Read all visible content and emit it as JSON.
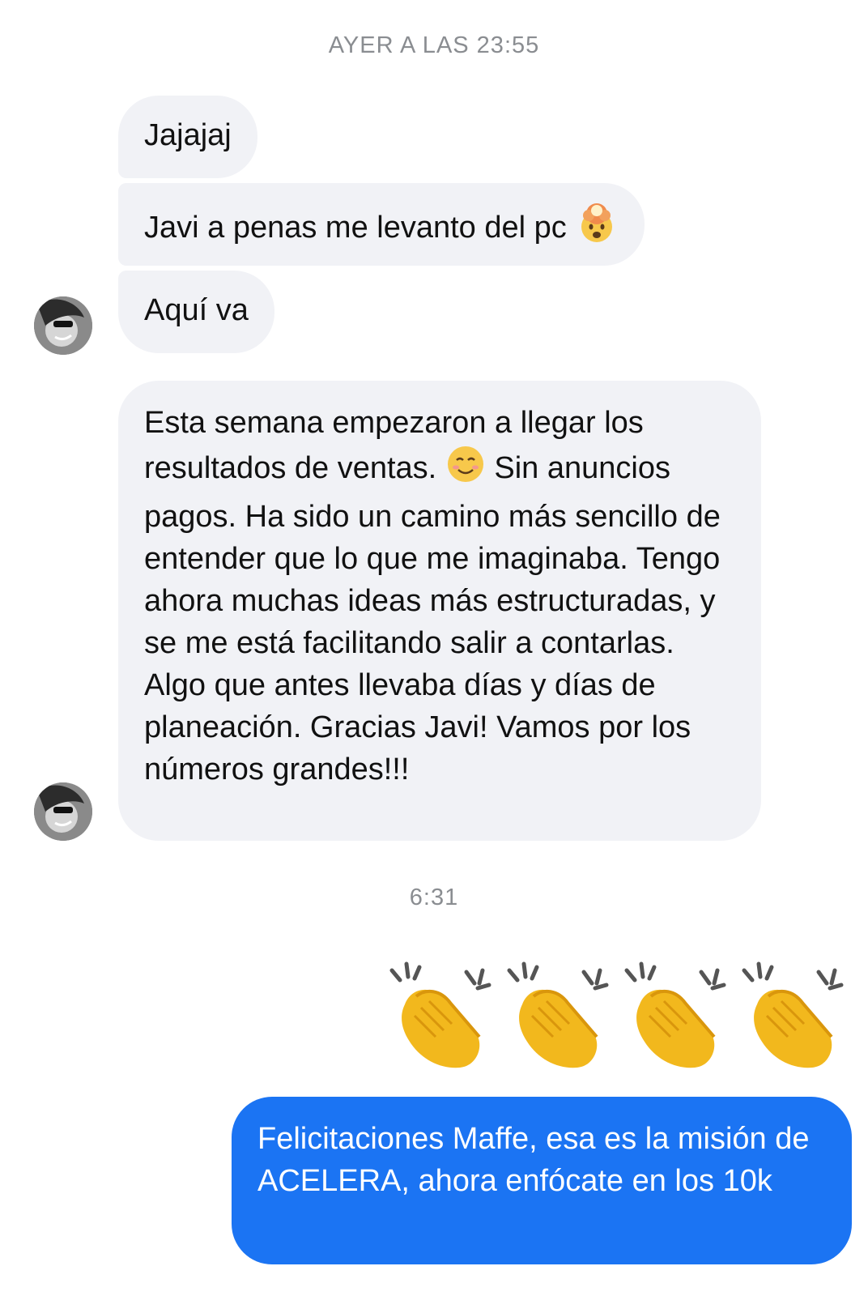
{
  "timestamps": {
    "first": "AYER A LAS 23:55",
    "second": "6:31"
  },
  "messages": {
    "incoming": [
      {
        "text": "Jajajaj",
        "emoji": ""
      },
      {
        "text": "Javi a penas me levanto del pc",
        "emoji": "🤯"
      },
      {
        "text": "Aquí va",
        "emoji": ""
      }
    ],
    "long_message": {
      "part1": "Esta semana empezaron a llegar los resultados de ventas.",
      "emoji": "☺️",
      "part2": "Sin anuncios pagos. Ha sido un camino más sencillo de entender que lo que me imaginaba. Tengo ahora muchas ideas más estructuradas, y se me está facilitando salir a contarlas. Algo que antes llevaba días y días de planeación. Gracias Javi! Vamos por los números grandes!!!"
    },
    "outgoing_emoji": "👏👏👏👏",
    "outgoing_text": "Felicitaciones Maffe, esa es la misión de ACELERA, ahora enfócate en los 10k"
  },
  "colors": {
    "incoming_bubble": "#f1f2f6",
    "outgoing_bubble": "#1b74f3",
    "timestamp": "#8a8d91"
  },
  "icons": {
    "mind_blown": "exploding-head-icon",
    "smiling": "smiling-face-icon",
    "clapping": "clapping-hands-icon"
  }
}
